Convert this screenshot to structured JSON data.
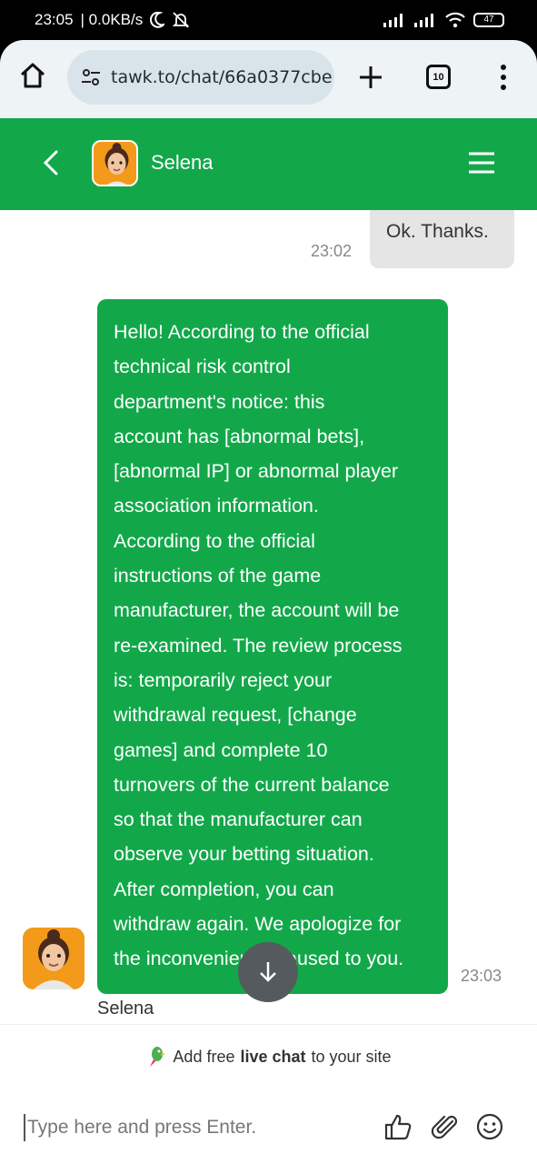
{
  "status_bar": {
    "time": "23:05",
    "speed": "| 0.0KB/s",
    "battery": "47"
  },
  "browser": {
    "url": "tawk.to/chat/66a0377cbe",
    "tab_count": "10"
  },
  "header": {
    "agent_name": "Selena"
  },
  "messages": {
    "user_text": "Ok. Thanks.",
    "user_time": "23:02",
    "agent_lines": [
      "Hello! According to the official",
      "technical risk control",
      "department's notice: this",
      "account has [abnormal bets],",
      "[abnormal IP] or abnormal player",
      "association information.",
      "According to the official",
      "instructions of the game",
      "manufacturer, the account will be",
      "re-examined. The review process",
      "is: temporarily reject your",
      "withdrawal request, [change",
      "games] and complete 10",
      "turnovers of the current balance",
      "so that the manufacturer can",
      "observe your betting situation.",
      "After completion, you can",
      "withdraw again. We apologize for",
      "the inconvenience caused to you."
    ],
    "agent_time": "23:03",
    "agent_name": "Selena"
  },
  "footer": {
    "promo_prefix": "Add free",
    "promo_bold": "live chat",
    "promo_suffix": "to your site",
    "input_placeholder": "Type here and press Enter."
  },
  "colors": {
    "brand_green": "#12a84a",
    "user_bubble": "#e5e5e5",
    "avatar_bg": "#f39a1a"
  }
}
